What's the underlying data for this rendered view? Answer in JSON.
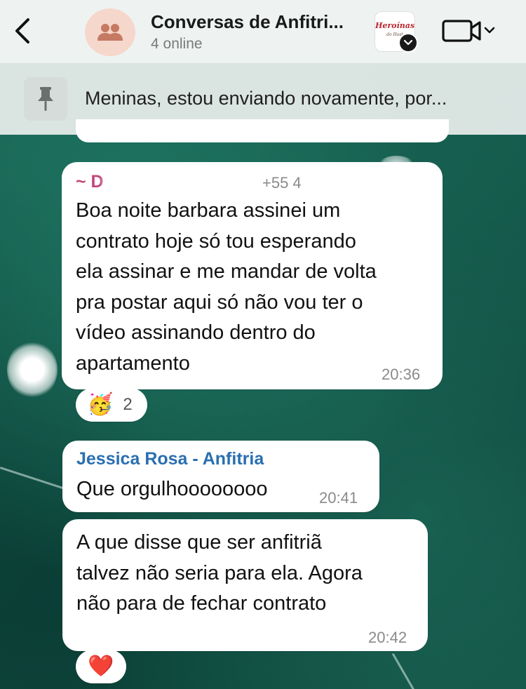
{
  "header": {
    "title": "Conversas de Anfitri...",
    "subtitle": "4 online",
    "logo_line1": "Heroínas",
    "logo_line2": "do Host",
    "back_icon": "chevron-left-icon",
    "video_icon": "video-camera-icon"
  },
  "pinned": {
    "text": "Meninas, estou enviando novamente, por..."
  },
  "messages": [
    {
      "sender": "~ D",
      "phone": "+55 4",
      "sender_color": "#c2467a",
      "text": "Boa noite barbara  assinei um\ncontrato hoje só tou esperando\nela assinar e me mandar de volta\npra postar aqui só não vou ter o\nvídeo  assinando dentro do\napartamento",
      "time": "20:36",
      "reaction": {
        "emoji": "🥳",
        "count": "2"
      }
    },
    {
      "sender": "Jessica Rosa - Anfitria",
      "sender_color": "#2a6fb0",
      "text": "Que orgulhoooooooo",
      "time": "20:41"
    },
    {
      "text": "A que disse que ser anfitriã\ntalvez não seria para ela. Agora\nnão para de fechar contrato",
      "time": "20:42",
      "reaction": {
        "emoji": "❤️"
      }
    }
  ],
  "colors": {
    "header_bg": "#eef3f2",
    "avatar_bg": "#f6d7cb",
    "avatar_icon": "#c57a63",
    "wallpaper": "#145a4c"
  }
}
